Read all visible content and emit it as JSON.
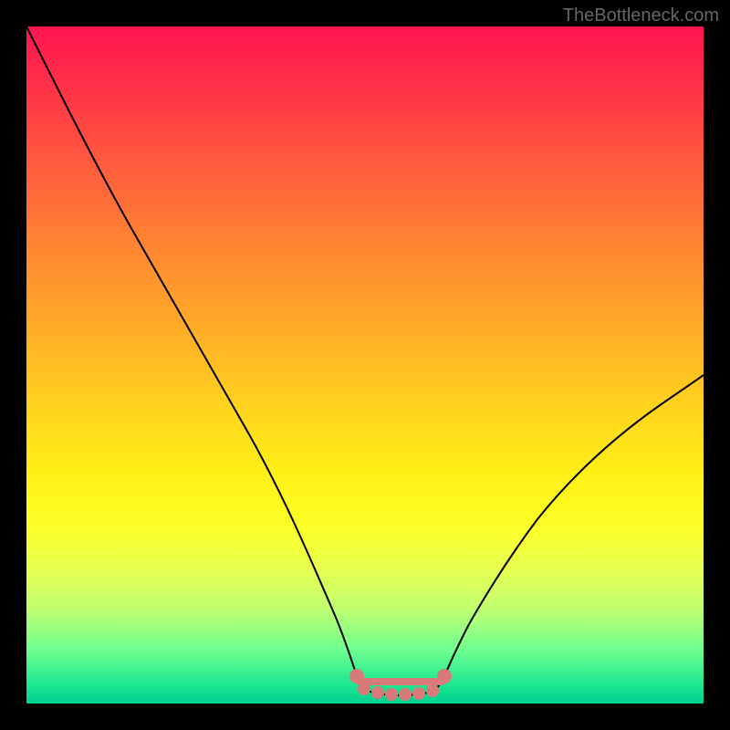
{
  "watermark": "TheBottleneck.com",
  "chart_data": {
    "type": "line",
    "title": "",
    "xlabel": "",
    "ylabel": "",
    "xlim": [
      0,
      1
    ],
    "ylim": [
      0,
      1
    ],
    "series": [
      {
        "name": "curve",
        "x": [
          0.0,
          0.05,
          0.1,
          0.15,
          0.2,
          0.25,
          0.3,
          0.35,
          0.4,
          0.45,
          0.48,
          0.5,
          0.55,
          0.6,
          0.62,
          0.65,
          0.7,
          0.75,
          0.8,
          0.85,
          0.9,
          0.95,
          1.0
        ],
        "y": [
          1.0,
          0.9,
          0.8,
          0.7,
          0.6,
          0.5,
          0.4,
          0.3,
          0.2,
          0.1,
          0.05,
          0.03,
          0.02,
          0.03,
          0.05,
          0.1,
          0.17,
          0.25,
          0.32,
          0.39,
          0.45,
          0.5,
          0.55
        ]
      }
    ],
    "markers": {
      "name": "highlight",
      "color": "#d97a7a",
      "x": [
        0.48,
        0.5,
        0.52,
        0.54,
        0.56,
        0.58,
        0.6,
        0.62
      ],
      "y": [
        0.05,
        0.03,
        0.02,
        0.02,
        0.02,
        0.02,
        0.03,
        0.05
      ]
    },
    "gradient_stops": [
      {
        "pos": 0.0,
        "color": "#ff1450"
      },
      {
        "pos": 0.2,
        "color": "#ff5a3e"
      },
      {
        "pos": 0.44,
        "color": "#ffaa28"
      },
      {
        "pos": 0.66,
        "color": "#fff016"
      },
      {
        "pos": 0.86,
        "color": "#c0ff70"
      },
      {
        "pos": 1.0,
        "color": "#00d090"
      }
    ]
  }
}
